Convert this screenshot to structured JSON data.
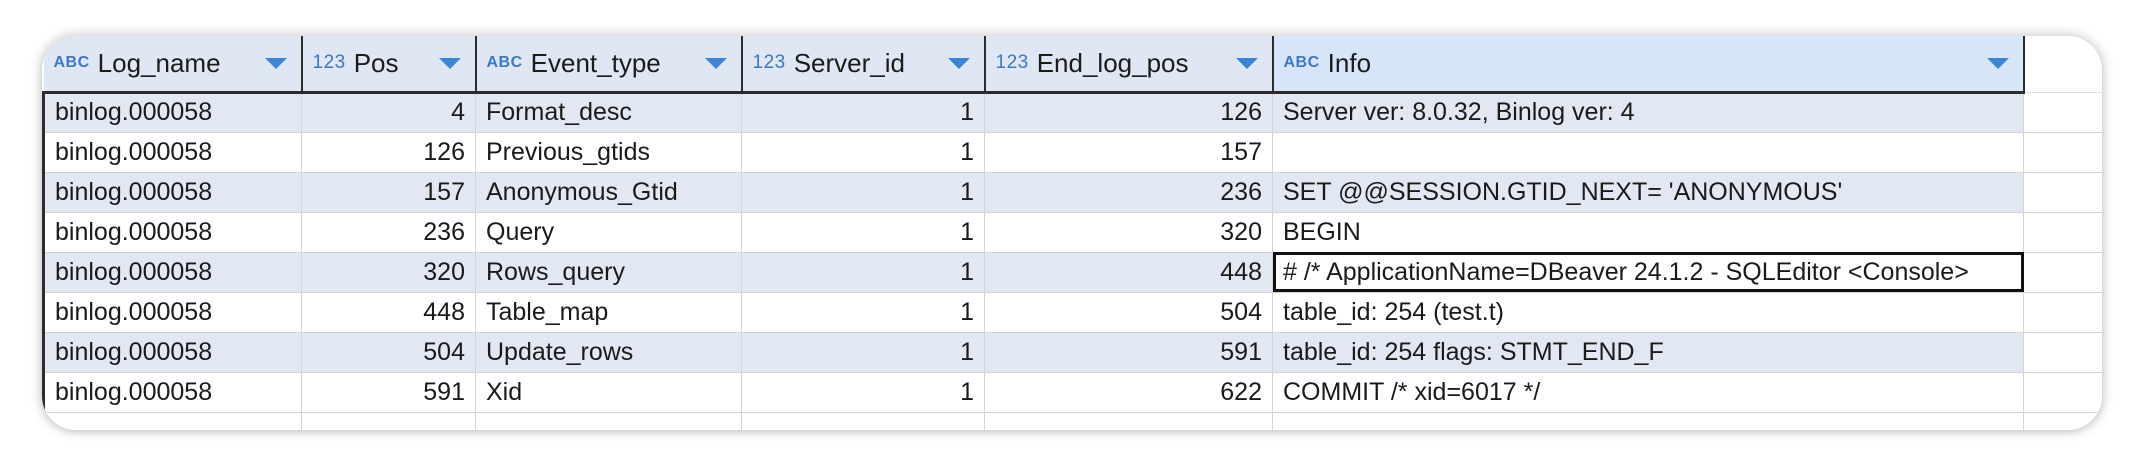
{
  "columns": [
    {
      "name": "Log_name",
      "type": "ABC"
    },
    {
      "name": "Pos",
      "type": "123"
    },
    {
      "name": "Event_type",
      "type": "ABC"
    },
    {
      "name": "Server_id",
      "type": "123"
    },
    {
      "name": "End_log_pos",
      "type": "123"
    },
    {
      "name": "Info",
      "type": "ABC"
    }
  ],
  "rows": [
    [
      "binlog.000058",
      "4",
      "Format_desc",
      "1",
      "126",
      "Server ver: 8.0.32, Binlog ver: 4"
    ],
    [
      "binlog.000058",
      "126",
      "Previous_gtids",
      "1",
      "157",
      ""
    ],
    [
      "binlog.000058",
      "157",
      "Anonymous_Gtid",
      "1",
      "236",
      "SET @@SESSION.GTID_NEXT= 'ANONYMOUS'"
    ],
    [
      "binlog.000058",
      "236",
      "Query",
      "1",
      "320",
      "BEGIN"
    ],
    [
      "binlog.000058",
      "320",
      "Rows_query",
      "1",
      "448",
      "# /* ApplicationName=DBeaver 24.1.2 - SQLEditor <Console>"
    ],
    [
      "binlog.000058",
      "448",
      "Table_map",
      "1",
      "504",
      "table_id: 254 (test.t)"
    ],
    [
      "binlog.000058",
      "504",
      "Update_rows",
      "1",
      "591",
      "table_id: 254 flags: STMT_END_F"
    ],
    [
      "binlog.000058",
      "591",
      "Xid",
      "1",
      "622",
      "COMMIT /* xid=6017 */"
    ]
  ],
  "selected_cell": {
    "row": 4,
    "column": "Info"
  }
}
